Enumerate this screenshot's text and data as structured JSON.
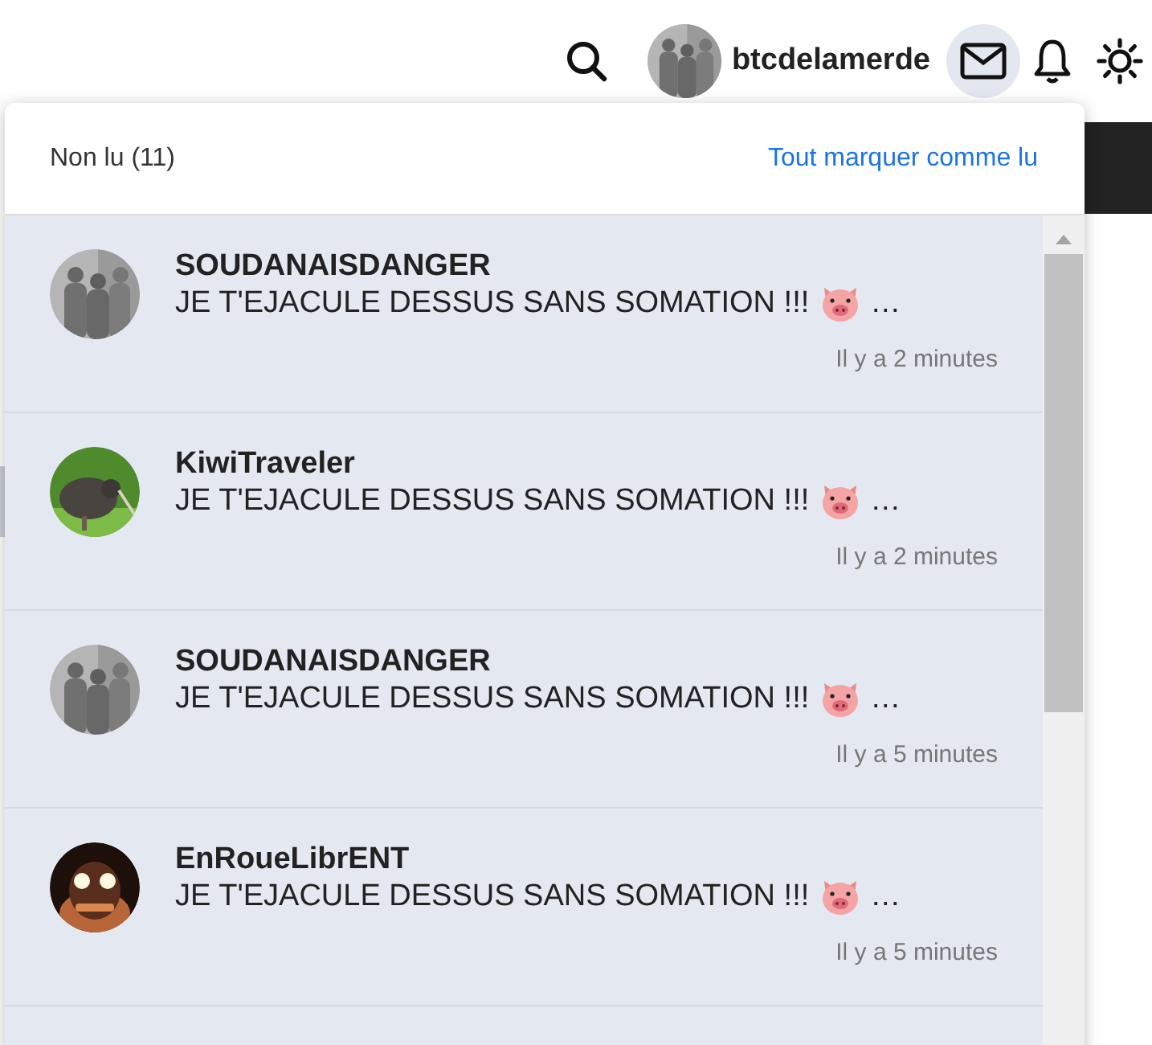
{
  "top_bar": {
    "username": "btcdelamerde",
    "mail_active": true
  },
  "dropdown": {
    "title": "Non lu (11)",
    "mark_all_link": "Tout marquer comme lu",
    "notifications": [
      {
        "author": "SOUDANAISDANGER",
        "message": "JE T'EJACULE DESSUS SANS SOMATION !!!",
        "ellipsis": "…",
        "time": "Il y a 2 minutes"
      },
      {
        "author": "KiwiTraveler",
        "message": "JE T'EJACULE DESSUS SANS SOMATION !!!",
        "ellipsis": "…",
        "time": "Il y a 2 minutes"
      },
      {
        "author": "SOUDANAISDANGER",
        "message": "JE T'EJACULE DESSUS SANS SOMATION !!!",
        "ellipsis": "…",
        "time": "Il y a 5 minutes"
      },
      {
        "author": "EnRoueLibrENT",
        "message": "JE T'EJACULE DESSUS SANS SOMATION !!!",
        "ellipsis": "…",
        "time": "Il y a 5 minutes"
      }
    ]
  }
}
